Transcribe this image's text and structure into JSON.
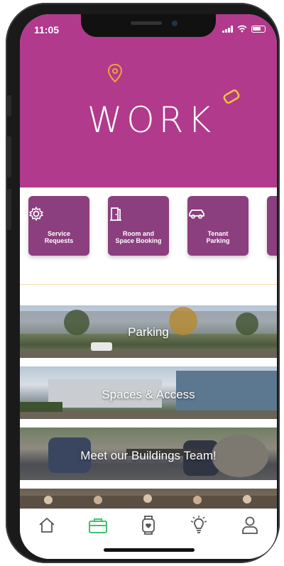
{
  "status_bar": {
    "time": "11:05"
  },
  "hero": {
    "logo_text": "WORK",
    "background_color": "#b13a8c"
  },
  "quick_actions": [
    {
      "label": "Service\nRequests",
      "icon": "gear-icon"
    },
    {
      "label": "Room and\nSpace Booking",
      "icon": "door-icon"
    },
    {
      "label": "Tenant\nParking",
      "icon": "car-icon"
    }
  ],
  "banners": [
    {
      "title": "Parking"
    },
    {
      "title": "Spaces & Access"
    },
    {
      "title": "Meet our Buildings Team!"
    }
  ],
  "tab_bar": {
    "tabs": [
      {
        "icon": "home-icon",
        "active": false
      },
      {
        "icon": "briefcase-icon",
        "active": true
      },
      {
        "icon": "watch-heart-icon",
        "active": false
      },
      {
        "icon": "lightbulb-icon",
        "active": false
      },
      {
        "icon": "profile-icon",
        "active": false
      }
    ],
    "active_color": "#3cc36b"
  }
}
